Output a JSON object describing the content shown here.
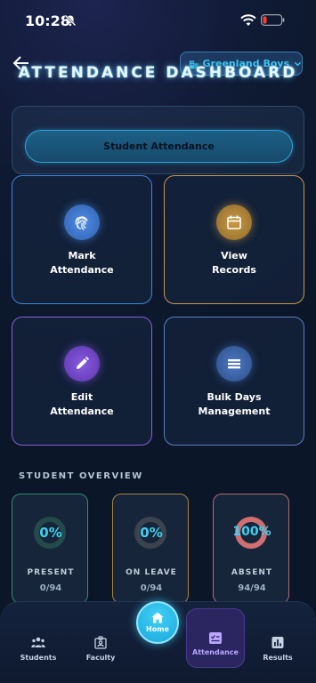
{
  "status_bar": {
    "time": "10:28"
  },
  "header": {
    "title": "ATTENDANCE DASHBOARD",
    "school_selector": {
      "value": "Greenland Boys"
    }
  },
  "section": {
    "button_label": "Student Attendance"
  },
  "cards": [
    {
      "line1": "Mark",
      "line2": "Attendance",
      "icon": "fingerprint-icon"
    },
    {
      "line1": "View",
      "line2": "Records",
      "icon": "calendar-icon"
    },
    {
      "line1": "Edit",
      "line2": "Attendance",
      "icon": "pencil-icon"
    },
    {
      "line1": "Bulk Days",
      "line2": "Management",
      "icon": "stack-icon"
    }
  ],
  "overview": {
    "heading": "STUDENT OVERVIEW",
    "stats": [
      {
        "percent": "0%",
        "label": "PRESENT",
        "count": "0/94",
        "color": "#2f8f72"
      },
      {
        "percent": "0%",
        "label": "ON LEAVE",
        "count": "0/94",
        "color": "#a8843f"
      },
      {
        "percent": "100%",
        "label": "ABSENT",
        "count": "94/94",
        "color": "#d06f6f"
      }
    ]
  },
  "bottom_nav": {
    "students": "Students",
    "faculty": "Faculty",
    "home": "Home",
    "attendance": "Attendance",
    "results": "Results"
  },
  "colors": {
    "accent_cyan": "#29a8d8",
    "active_tab": "#2c2660",
    "background": "#0b1628"
  }
}
